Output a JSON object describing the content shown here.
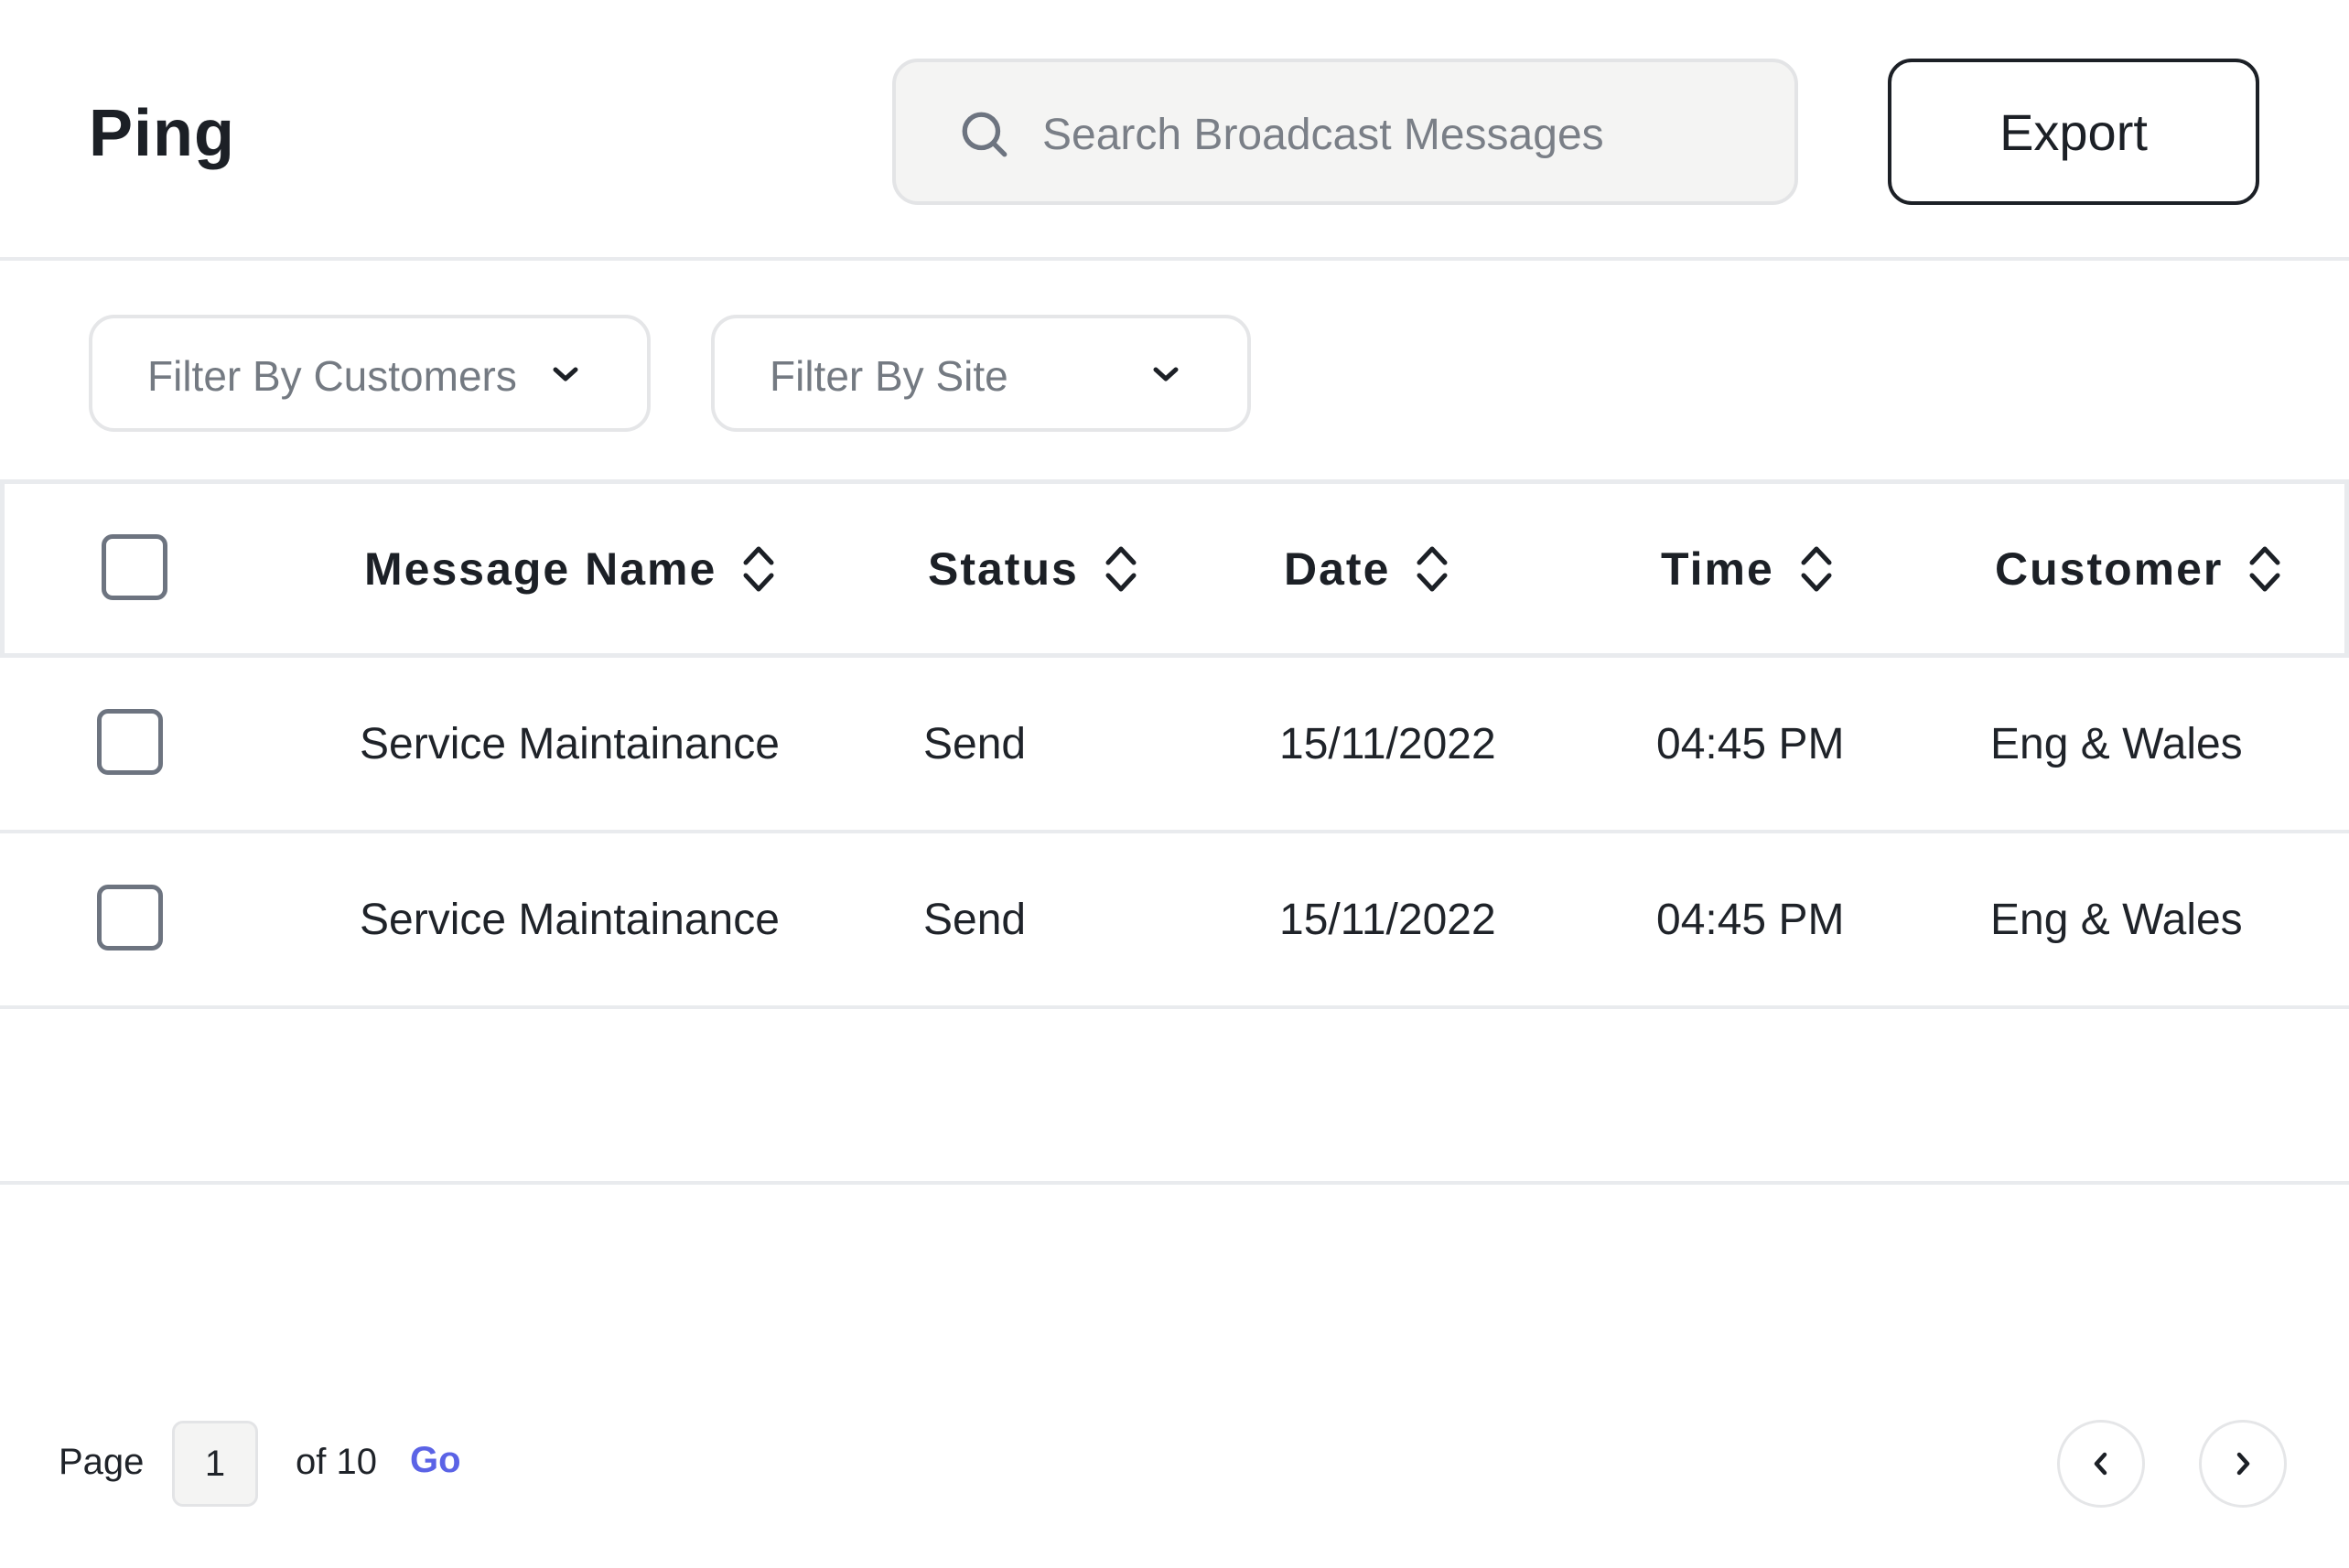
{
  "header": {
    "title": "Ping",
    "search": {
      "placeholder": "Search Broadcast Messages",
      "value": ""
    },
    "export_label": "Export"
  },
  "filters": {
    "customers": {
      "label": "Filter By Customers",
      "icon": "chevron-down-icon"
    },
    "site": {
      "label": "Filter By Site",
      "icon": "chevron-down-icon"
    }
  },
  "table": {
    "columns": {
      "message_name": "Message Name",
      "status": "Status",
      "date": "Date",
      "time": "Time",
      "customer": "Customer"
    },
    "rows": [
      {
        "message_name": "Service Maintainance",
        "status": "Send",
        "date": "15/11/2022",
        "time": "04:45 PM",
        "customer": "Eng & Wales"
      },
      {
        "message_name": "Service Maintainance",
        "status": "Send",
        "date": "15/11/2022",
        "time": "04:45 PM",
        "customer": "Eng & Wales"
      }
    ]
  },
  "pagination": {
    "page_label": "Page",
    "current_page": "1",
    "of_label": "of 10",
    "go_label": "Go"
  },
  "colors": {
    "accent": "#5b63e6",
    "text": "#1c2026",
    "muted": "#747a82",
    "border": "#e9ebee",
    "search_bg": "#f4f4f3"
  }
}
